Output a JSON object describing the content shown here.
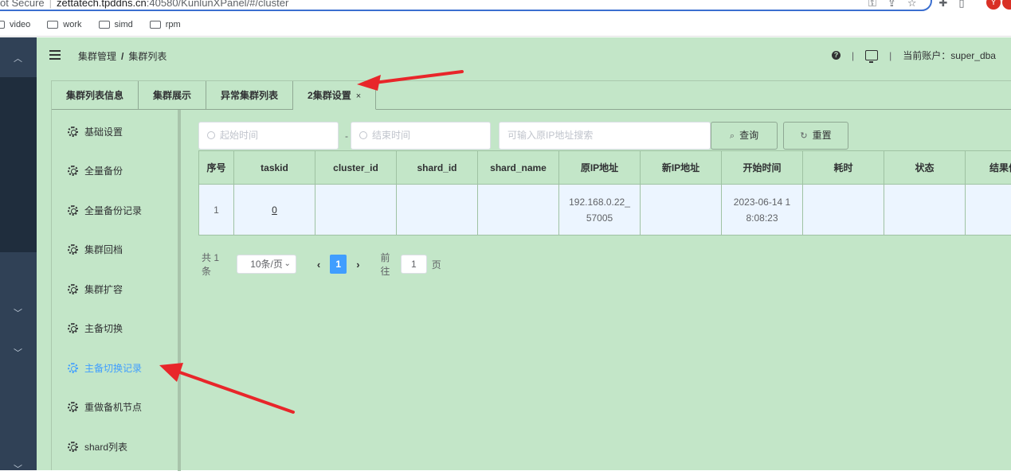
{
  "browser": {
    "security": "ot Secure",
    "url_host": "zettatech.tpddns.cn",
    "url_rest": ":40580/KunlunXPanel/#/cluster",
    "avatar_letter": "Y",
    "bookmarks": [
      "video",
      "work",
      "simd",
      "rpm"
    ]
  },
  "navbar": {
    "breadcrumb_parent": "集群管理",
    "breadcrumb_sep": "/",
    "breadcrumb_current": "集群列表",
    "account_label": "当前账户：super_dba"
  },
  "tabs": [
    {
      "label": "集群列表信息"
    },
    {
      "label": "集群展示"
    },
    {
      "label": "异常集群列表"
    },
    {
      "label": "2集群设置",
      "close": "×"
    }
  ],
  "menu": [
    "基础设置",
    "全量备份",
    "全量备份记录",
    "集群回档",
    "集群扩容",
    "主备切换",
    "主备切换记录",
    "重做备机节点",
    "shard列表"
  ],
  "active_menu_index": 6,
  "filters": {
    "start_placeholder": "起始时间",
    "dash": "-",
    "end_placeholder": "结束时间",
    "ip_placeholder": "可输入原IP地址搜索",
    "search_label": "查询",
    "reset_label": "重置"
  },
  "table": {
    "headers": [
      "序号",
      "taskid",
      "cluster_id",
      "shard_id",
      "shard_name",
      "原IP地址",
      "新IP地址",
      "开始时间",
      "耗时",
      "状态",
      "结果信"
    ],
    "rows": [
      [
        "1",
        "0",
        "",
        "",
        "",
        "192.168.0.22_\n57005",
        "",
        "2023-06-14 1\n8:08:23",
        "",
        "",
        ""
      ]
    ]
  },
  "pagination": {
    "total": "共 1 条",
    "page_size": "10条/页",
    "current": "1",
    "goto_label": "前往",
    "goto_value": "1",
    "page_unit": "页"
  },
  "colors": {
    "accent": "#409eff",
    "background": "#c3e6c8",
    "sidebar": "#304156",
    "annotation": "#e8262a"
  }
}
